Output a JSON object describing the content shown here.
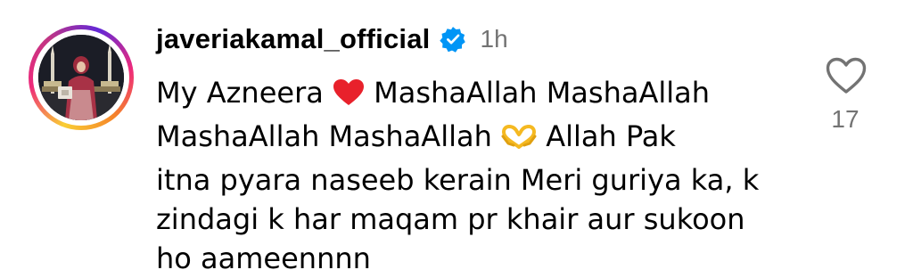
{
  "comment": {
    "username": "javeriakamal_official",
    "verified_icon": "verified-badge-icon",
    "timestamp": "1h",
    "text_lines": [
      {
        "before": "My Azneera ",
        "emoji": "red-heart-emoji",
        "after": " MashaAllah MashaAllah"
      },
      {
        "before": "MashaAllah MashaAllah ",
        "emoji": "heart-hands-emoji",
        "after": " Allah Pak"
      },
      {
        "before": "itna pyara naseeb kerain Meri guriya ka, k"
      },
      {
        "before": "zindagi k har maqam pr khair aur sukoon"
      },
      {
        "before": "ho aameennnn"
      }
    ],
    "like_icon": "heart-outline-icon",
    "like_count": "17"
  },
  "colors": {
    "verified": "#0095f6",
    "secondary_text": "#737373",
    "red_heart": "#e8212b",
    "heart_hands": "#f5b921"
  }
}
